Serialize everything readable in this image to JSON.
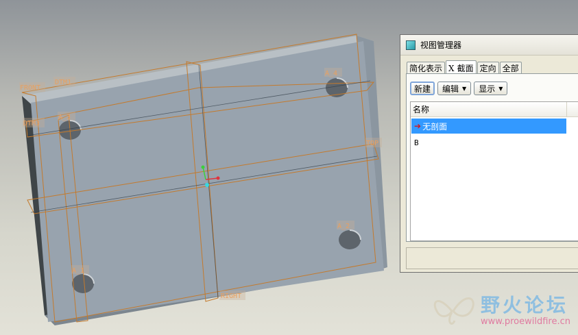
{
  "viewport": {
    "datums": {
      "front": "FRONT",
      "dtm1": "DTM1",
      "dtm3": "DTM3",
      "top": "TOP",
      "right": "RIGHT"
    },
    "axes": {
      "a1": "A_1",
      "a2": "A_2",
      "a3": "A_3",
      "a4": "A_4"
    }
  },
  "view_manager": {
    "title": "视图管理器",
    "tabs": [
      {
        "label": "简化表示"
      },
      {
        "prefix": "X",
        "label": "截面"
      },
      {
        "label": "定向"
      },
      {
        "label": "全部"
      }
    ],
    "buttons": {
      "new": "新建",
      "edit": "编辑",
      "display": "显示"
    },
    "list": {
      "column_header": "名称",
      "items": [
        {
          "name": "无剖面",
          "selected": true
        },
        {
          "name": "B",
          "selected": false
        }
      ]
    }
  },
  "watermark": {
    "title": "野火论坛",
    "url": "www.proewildfire.cn"
  },
  "colors": {
    "datum": "#c47a2c",
    "part_top": "#98a3ae",
    "selection": "#3399ff"
  }
}
